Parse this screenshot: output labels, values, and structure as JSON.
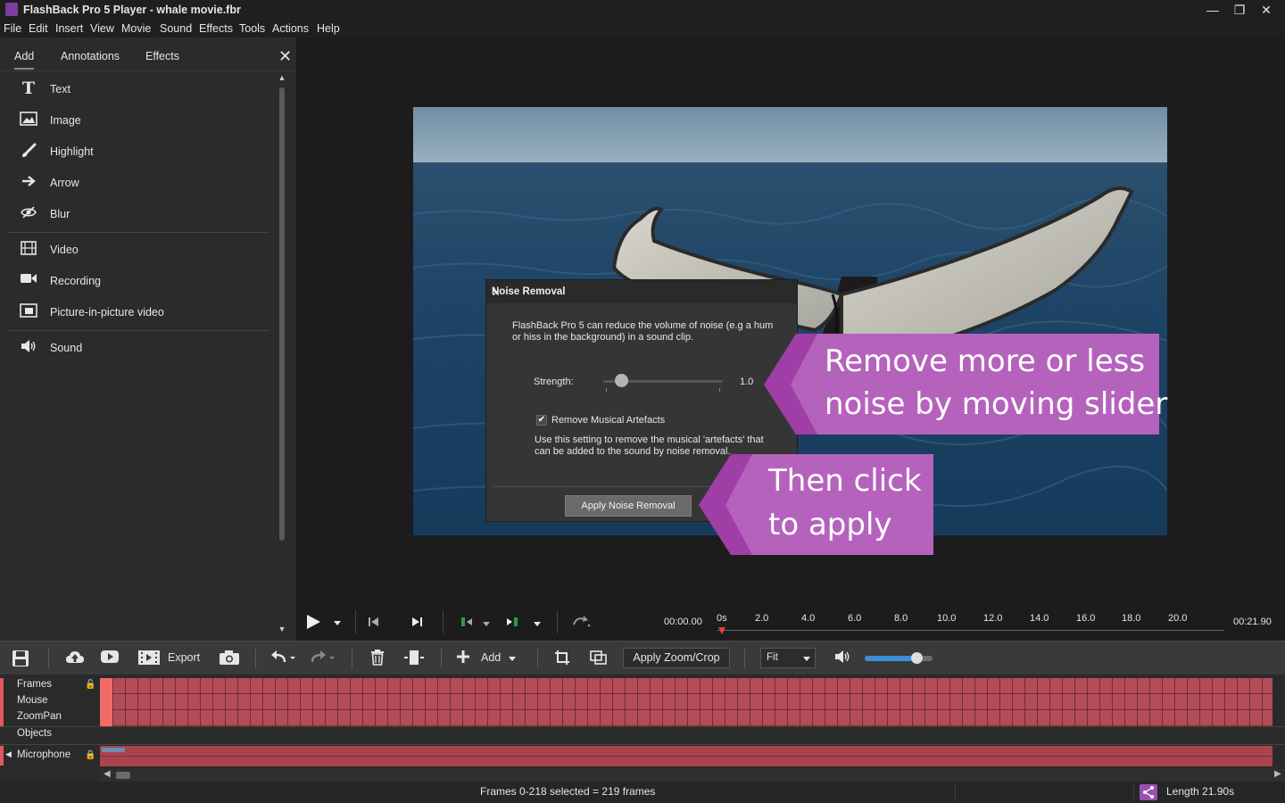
{
  "window": {
    "title": "FlashBack Pro 5 Player - whale movie.fbr",
    "controls": [
      "minimize",
      "restore",
      "close"
    ]
  },
  "menu": [
    "File",
    "Edit",
    "Insert",
    "View",
    "Movie",
    "Sound",
    "Effects",
    "Tools",
    "Actions",
    "Help"
  ],
  "panel": {
    "tabs": [
      {
        "label": "Add",
        "active": true
      },
      {
        "label": "Annotations",
        "active": false
      },
      {
        "label": "Effects",
        "active": false
      }
    ],
    "items": [
      {
        "label": "Text",
        "icon": "text-icon"
      },
      {
        "label": "Image",
        "icon": "image-icon"
      },
      {
        "label": "Highlight",
        "icon": "brush-icon"
      },
      {
        "label": "Arrow",
        "icon": "arrow-right-icon"
      },
      {
        "label": "Blur",
        "icon": "blur-eye-icon"
      },
      {
        "label": "Video",
        "icon": "film-icon"
      },
      {
        "label": "Recording",
        "icon": "camera-icon"
      },
      {
        "label": "Picture-in-picture video",
        "icon": "pip-icon"
      },
      {
        "label": "Sound",
        "icon": "speaker-icon"
      }
    ]
  },
  "dialog": {
    "title": "Noise Removal",
    "description_line1": "FlashBack Pro 5 can reduce the volume of noise (e.g a hum",
    "description_line2": "or hiss in the background) in a sound clip.",
    "strength_label": "Strength:",
    "strength_value": "1.0",
    "checkbox_label": "Remove Musical Artefacts",
    "checkbox_checked": true,
    "help_line1": "Use this setting to remove the musical 'artefacts' that",
    "help_line2": "can be added to the sound by noise removal.",
    "apply_label": "Apply Noise Removal"
  },
  "callouts": {
    "slider_line1": "Remove more or less",
    "slider_line2": "noise by moving slider",
    "apply_line1": "Then click",
    "apply_line2": "to apply",
    "color": "#b05cb8"
  },
  "transport": {
    "current_time": "00:00.00",
    "total_time": "00:21.90",
    "ticks": [
      "0s",
      "2.0",
      "4.0",
      "6.0",
      "8.0",
      "10.0",
      "12.0",
      "14.0",
      "16.0",
      "18.0",
      "20.0"
    ]
  },
  "toolbar": {
    "export_label": "Export",
    "add_label": "Add",
    "apply_zoom_label": "Apply Zoom/Crop",
    "fit_value": "Fit"
  },
  "tracks": {
    "labels": [
      "Frames",
      "Mouse",
      "ZoomPan",
      "Objects",
      "Microphone"
    ]
  },
  "status": {
    "selection": "Frames 0-218 selected = 219 frames",
    "length": "Length 21.90s"
  }
}
